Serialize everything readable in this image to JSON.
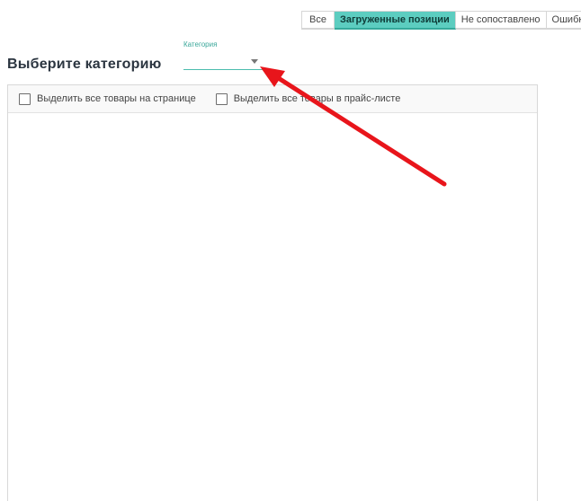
{
  "tabs": [
    {
      "label": "Все"
    },
    {
      "label": "Загруженные позиции"
    },
    {
      "label": "Не сопоставлено"
    },
    {
      "label": "Ошибки"
    }
  ],
  "active_tab": "Загруженные позиции",
  "page_title": "Выберите категорию",
  "category": {
    "label": "Категория",
    "value": ""
  },
  "table": {
    "select_page_label": "Выделить все товары на странице",
    "select_pricelist_label": "Выделить все товары в прайс-листе"
  },
  "colors": {
    "accent": "#5ccdc0",
    "annotation_arrow": "#e8151b"
  }
}
